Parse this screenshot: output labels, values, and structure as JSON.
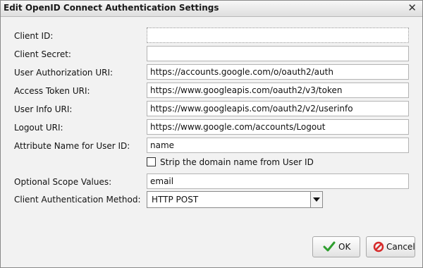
{
  "window": {
    "title": "Edit OpenID Connect Authentication Settings",
    "close_glyph": "✕"
  },
  "form": {
    "client_id": {
      "label": "Client ID:",
      "value": ""
    },
    "client_secret": {
      "label": "Client Secret:",
      "value": ""
    },
    "user_auth_uri": {
      "label": "User Authorization URI:",
      "value": "https://accounts.google.com/o/oauth2/auth"
    },
    "access_token_uri": {
      "label": "Access Token URI:",
      "value": "https://www.googleapis.com/oauth2/v3/token"
    },
    "user_info_uri": {
      "label": "User Info URI:",
      "value": "https://www.googleapis.com/oauth2/v2/userinfo"
    },
    "logout_uri": {
      "label": "Logout URI:",
      "value": "https://www.google.com/accounts/Logout"
    },
    "attribute_name": {
      "label": "Attribute Name for User ID:",
      "value": "name"
    },
    "strip_domain": {
      "label": "Strip the domain name from User ID",
      "checked": false
    },
    "scope_values": {
      "label": "Optional Scope Values:",
      "value": "email"
    },
    "client_auth_method": {
      "label": "Client Authentication Method:",
      "value": "HTTP POST"
    }
  },
  "buttons": {
    "ok": "OK",
    "cancel": "Cancel"
  },
  "icons": {
    "ok": "check-icon",
    "cancel": "cancel-icon",
    "dropdown": "chevron-down-icon",
    "close": "close-icon"
  },
  "colors": {
    "ok_check": "#2e9e2e",
    "cancel_icon": "#d62a2a"
  }
}
